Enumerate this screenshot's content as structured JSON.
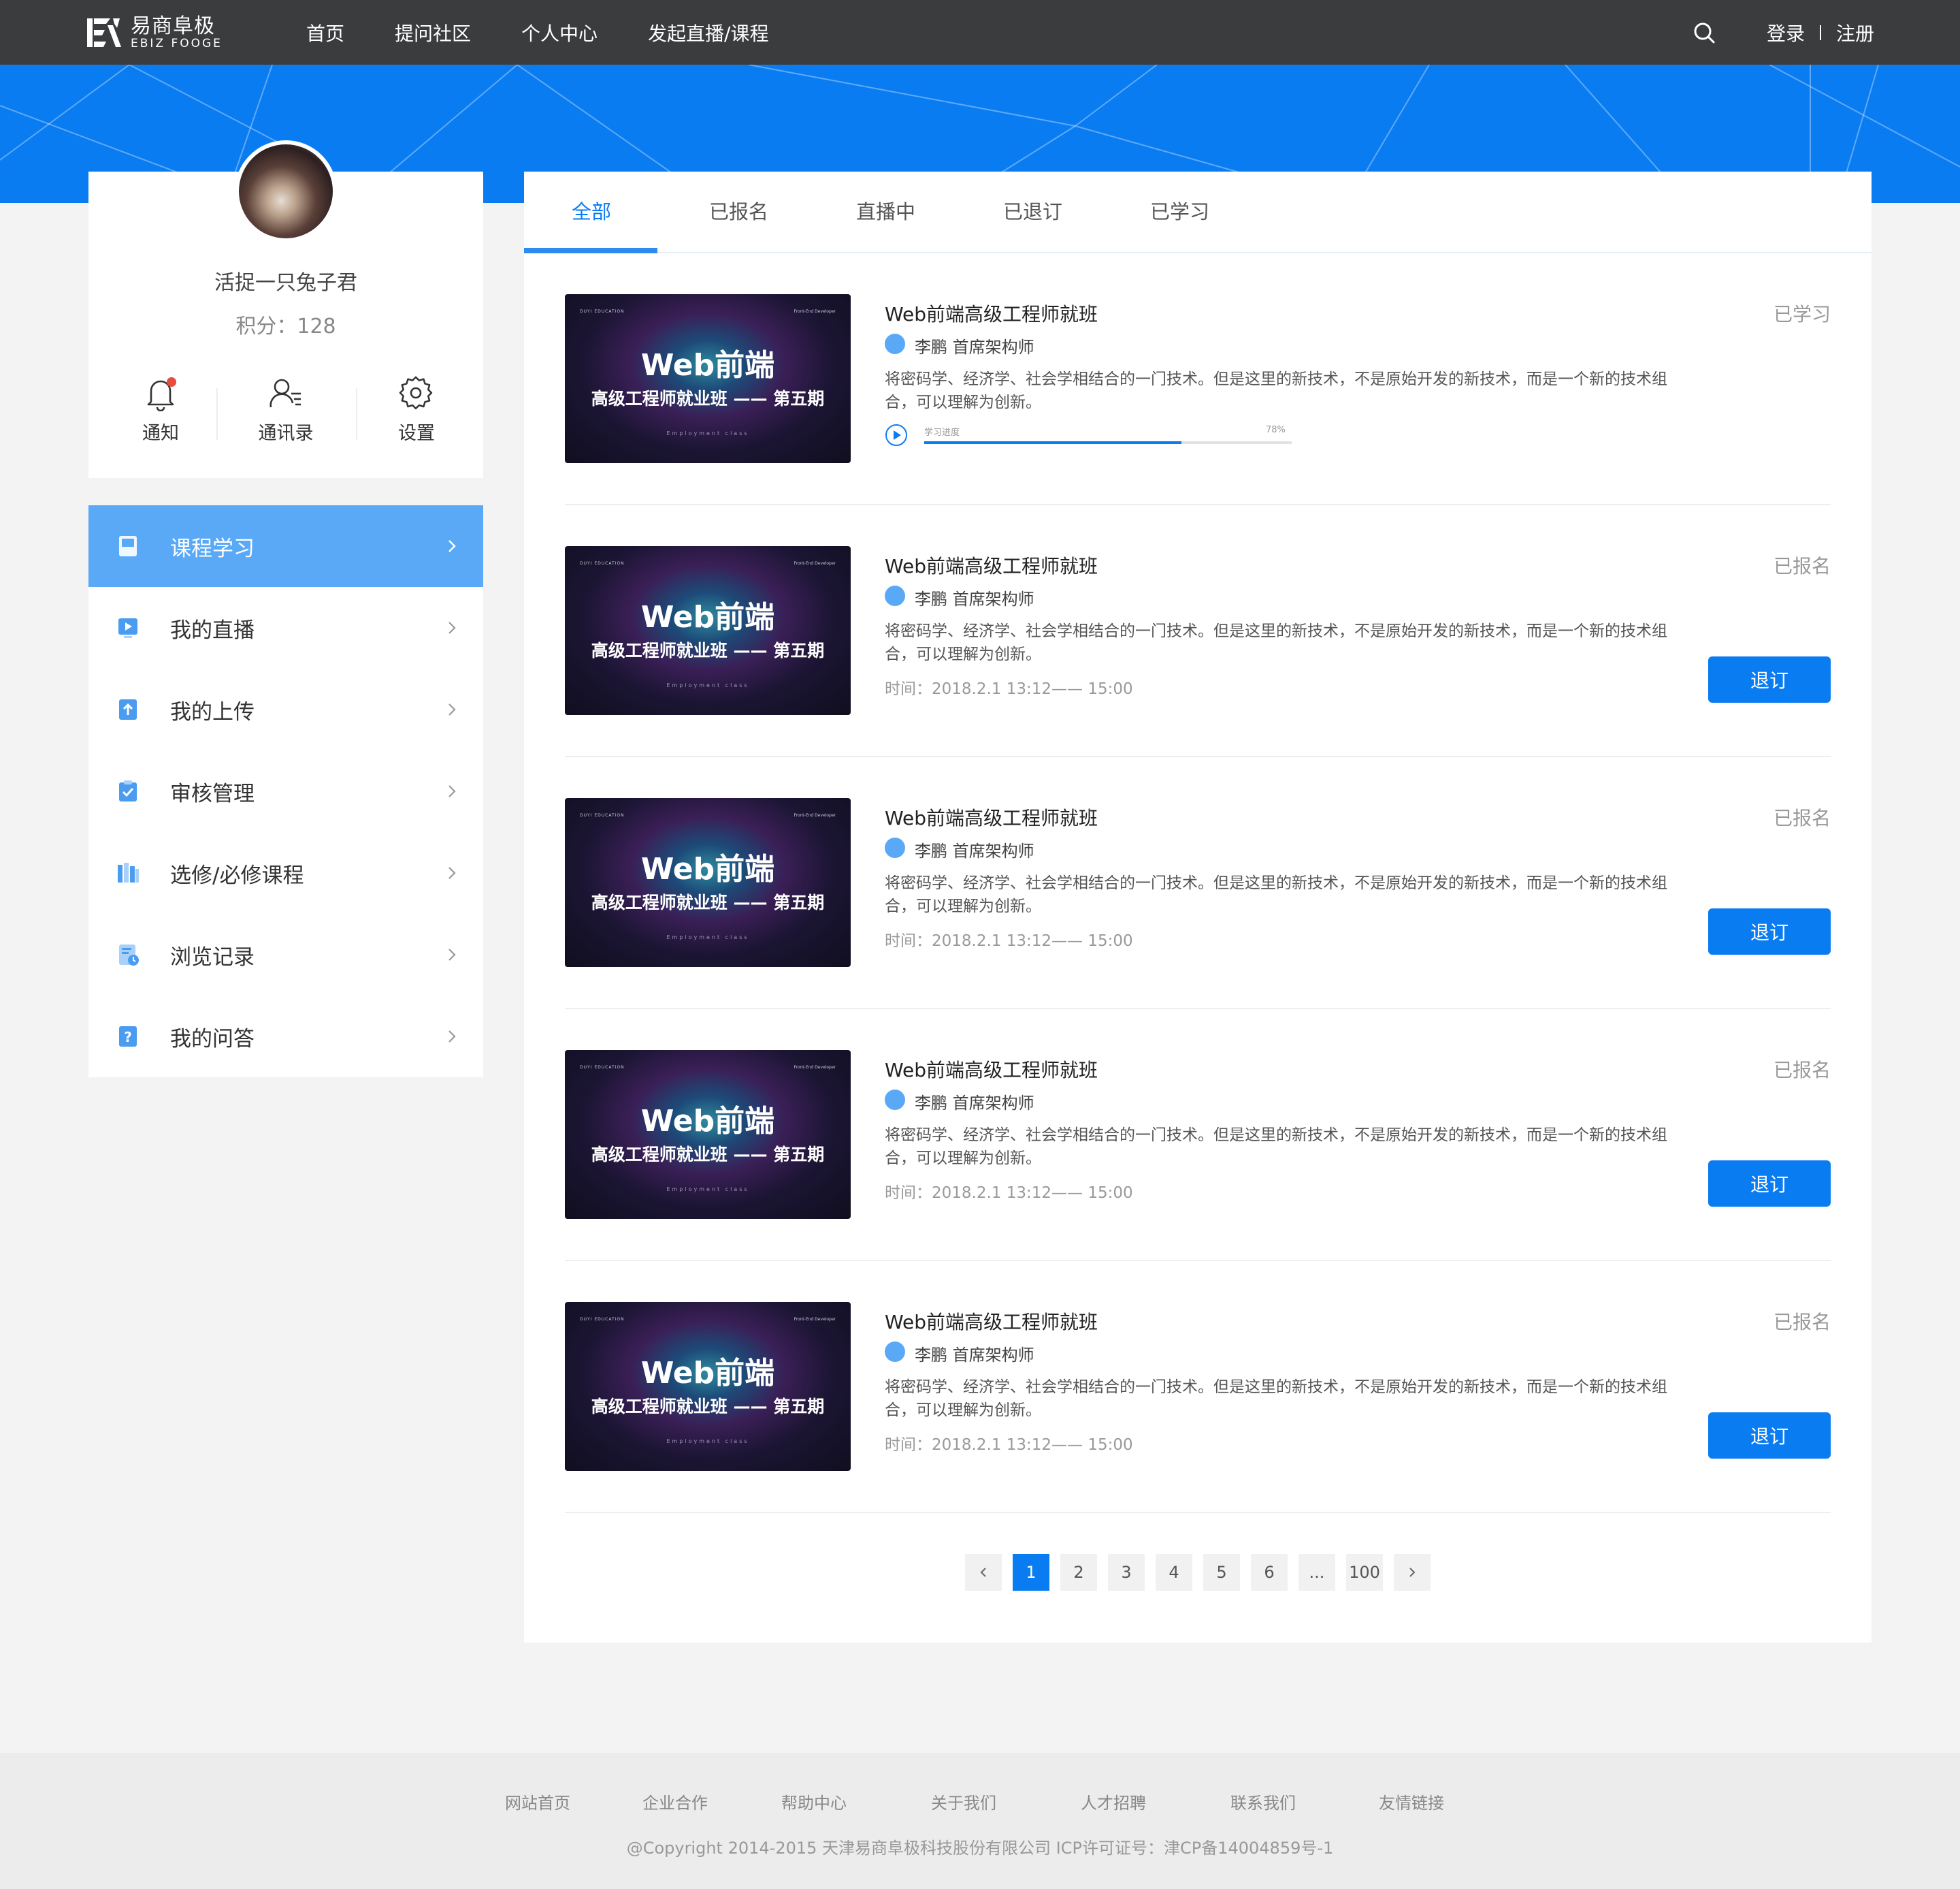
{
  "header": {
    "logo_cn": "易商阜极",
    "logo_en": "EBIZ FOOGE",
    "nav": [
      "首页",
      "提问社区",
      "个人中心",
      "发起直播/课程"
    ],
    "login": "登录",
    "register": "注册"
  },
  "profile": {
    "username": "活捉一只兔子君",
    "points": "积分：128",
    "quick_links": [
      "通知",
      "通讯录",
      "设置"
    ]
  },
  "sidebar": {
    "items": [
      {
        "label": "课程学习",
        "icon": "book-icon",
        "active": true
      },
      {
        "label": "我的直播",
        "icon": "live-icon",
        "active": false
      },
      {
        "label": "我的上传",
        "icon": "upload-icon",
        "active": false
      },
      {
        "label": "审核管理",
        "icon": "clipboard-check-icon",
        "active": false
      },
      {
        "label": "选修/必修课程",
        "icon": "bookshelf-icon",
        "active": false
      },
      {
        "label": "浏览记录",
        "icon": "history-icon",
        "active": false
      },
      {
        "label": "我的问答",
        "icon": "question-icon",
        "active": false
      }
    ]
  },
  "tabs": [
    "全部",
    "已报名",
    "直播中",
    "已退订",
    "已学习"
  ],
  "thumbnail": {
    "top_left": "DUYI EDUCATION",
    "top_right": "Front-End Developer",
    "title": "Web前端",
    "subtitle": "高级工程师就业班 —— 第五期",
    "footer": "Employment class"
  },
  "courses": [
    {
      "title": "Web前端高级工程师就班",
      "teacher": "李鹏   首席架构师",
      "desc": "将密码学、经济学、社会学相结合的一门技术。但是这里的新技术，不是原始开发的新技术，而是一个新的技术组合，可以理解为创新。",
      "status": "已学习",
      "progress_label": "学习进度",
      "progress_pct": "78%",
      "progress": 0.7
    },
    {
      "title": "Web前端高级工程师就班",
      "teacher": "李鹏   首席架构师",
      "desc": "将密码学、经济学、社会学相结合的一门技术。但是这里的新技术，不是原始开发的新技术，而是一个新的技术组合，可以理解为创新。",
      "status": "已报名",
      "time": "时间：2018.2.1 13:12—— 15:00",
      "button": "退订"
    },
    {
      "title": "Web前端高级工程师就班",
      "teacher": "李鹏   首席架构师",
      "desc": "将密码学、经济学、社会学相结合的一门技术。但是这里的新技术，不是原始开发的新技术，而是一个新的技术组合，可以理解为创新。",
      "status": "已报名",
      "time": "时间：2018.2.1 13:12—— 15:00",
      "button": "退订"
    },
    {
      "title": "Web前端高级工程师就班",
      "teacher": "李鹏   首席架构师",
      "desc": "将密码学、经济学、社会学相结合的一门技术。但是这里的新技术，不是原始开发的新技术，而是一个新的技术组合，可以理解为创新。",
      "status": "已报名",
      "time": "时间：2018.2.1 13:12—— 15:00",
      "button": "退订"
    },
    {
      "title": "Web前端高级工程师就班",
      "teacher": "李鹏   首席架构师",
      "desc": "将密码学、经济学、社会学相结合的一门技术。但是这里的新技术，不是原始开发的新技术，而是一个新的技术组合，可以理解为创新。",
      "status": "已报名",
      "time": "时间：2018.2.1 13:12—— 15:00",
      "button": "退订"
    }
  ],
  "pagination": {
    "pages": [
      "1",
      "2",
      "3",
      "4",
      "5",
      "6",
      "...",
      "100"
    ],
    "current": "1"
  },
  "footer": {
    "links": [
      "网站首页",
      "企业合作",
      "帮助中心",
      "关于我们",
      "人才招聘",
      "联系我们",
      "友情链接"
    ],
    "copyright": "@Copyright 2014-2015 天津易商阜极科技股份有限公司 ICP许可证号：津CP备14004859号-1"
  },
  "colors": {
    "accent": "#0a7cf2",
    "topbar": "#3b3c3e",
    "sidebar_active": "#5aa9f7",
    "badge": "#e74c3c"
  }
}
